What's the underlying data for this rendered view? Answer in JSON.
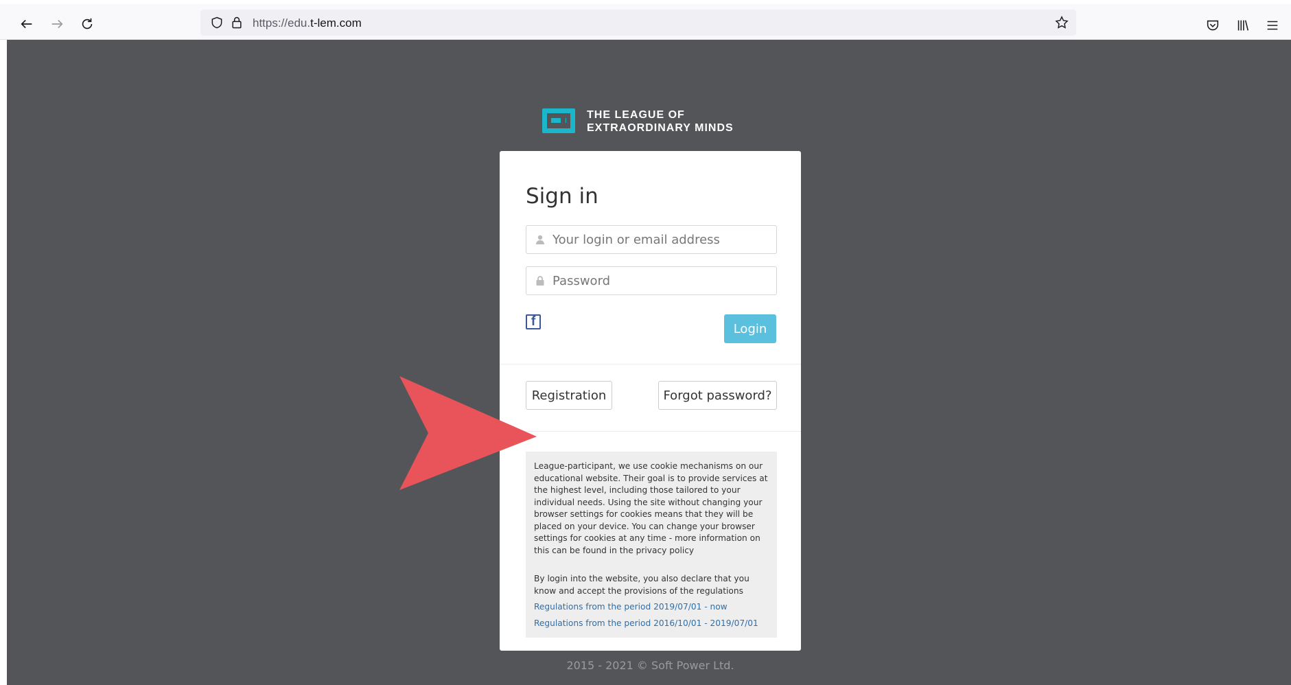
{
  "browser": {
    "url_prefix": "https://edu.",
    "url_host": "t-lem.com"
  },
  "logo": {
    "line1": "THE LEAGUE OF",
    "line2": "EXTRAORDINARY MINDS"
  },
  "signin": {
    "title": "Sign in",
    "login_placeholder": "Your login or email address",
    "password_placeholder": "Password",
    "login_button": "Login",
    "registration_button": "Registration",
    "forgot_button": "Forgot password?"
  },
  "cookie": {
    "text": "League-participant, we use cookie mechanisms on our educational website. Their goal is to provide services at the highest level, including those tailored to your individual needs. Using the site without changing your browser settings for cookies means that they will be placed on your device. You can change your browser settings for cookies at any time - more information on this can be found in the privacy policy",
    "regulations_text": "By login into the website, you also declare that you know and accept the provisions of the regulations",
    "link1": "Regulations from the period 2019/07/01 - now",
    "link2": "Regulations from the period 2016/10/01 - 2019/07/01"
  },
  "footer": {
    "text": "2015 - 2021 © Soft Power Ltd."
  },
  "colors": {
    "page_bg": "#545559",
    "accent": "#1bb6c9",
    "login_button": "#5bc0de",
    "annotation_arrow": "#e8545a"
  },
  "icons": {
    "back": "arrow-left-icon",
    "forward": "arrow-right-icon",
    "reload": "reload-icon",
    "shield": "tracking-shield-icon",
    "lock": "lock-icon",
    "bookmark": "star-icon",
    "pocket": "pocket-icon",
    "library": "library-icon",
    "menu": "hamburger-menu-icon",
    "user": "user-icon",
    "password": "lock-icon",
    "facebook": "facebook-icon"
  }
}
